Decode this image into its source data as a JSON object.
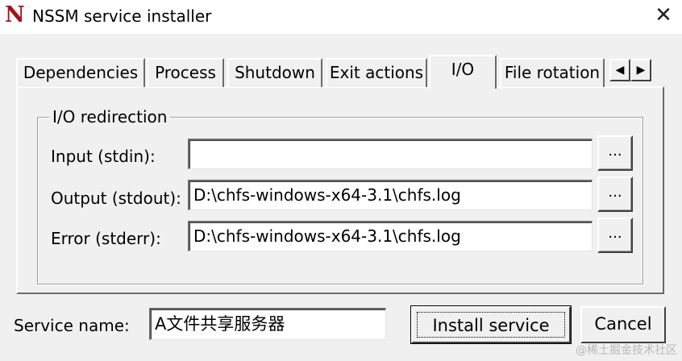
{
  "window": {
    "title": "NSSM service installer",
    "icon_letter": "N",
    "close_glyph": "✕"
  },
  "tabs": [
    {
      "label": "Dependencies",
      "active": false
    },
    {
      "label": "Process",
      "active": false
    },
    {
      "label": "Shutdown",
      "active": false
    },
    {
      "label": "Exit actions",
      "active": false
    },
    {
      "label": "I/O",
      "active": true
    },
    {
      "label": "File rotation",
      "active": false
    }
  ],
  "tab_scroll": {
    "left_glyph": "◀",
    "right_glyph": "▶"
  },
  "io_group": {
    "title": "I/O redirection",
    "fields": [
      {
        "label": "Input (stdin):",
        "value": "",
        "browse": "..."
      },
      {
        "label": "Output (stdout):",
        "value": "D:\\chfs-windows-x64-3.1\\chfs.log",
        "browse": "..."
      },
      {
        "label": "Error (stderr):",
        "value": "D:\\chfs-windows-x64-3.1\\chfs.log",
        "browse": "..."
      }
    ]
  },
  "service": {
    "label": "Service name:",
    "value": "A文件共享服务器"
  },
  "buttons": {
    "install": "Install service",
    "cancel": "Cancel"
  },
  "watermark": "@稀土掘金技术社区",
  "colors": {
    "icon_red": "#a0141e",
    "window_bg": "#f0f0f0"
  }
}
